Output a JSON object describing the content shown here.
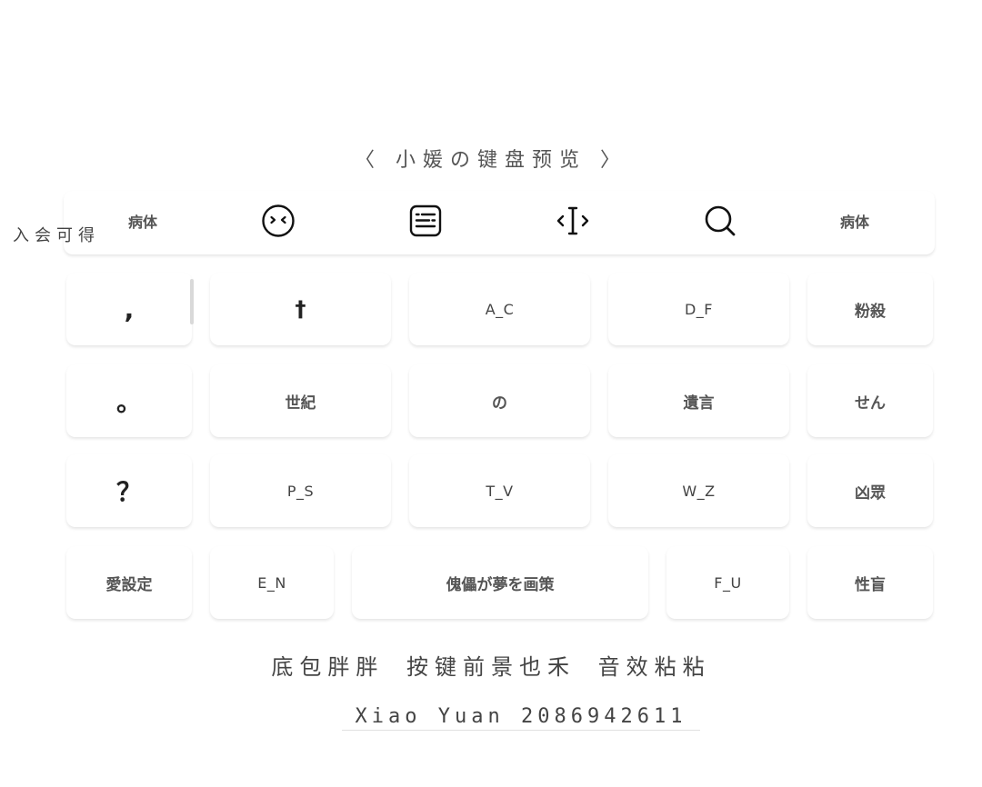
{
  "title": "〈 小媛の键盘预览 〉",
  "side_note": "入会可得",
  "toolbar": {
    "left_label": "病体",
    "right_label": "病体",
    "icons": [
      "emoji-face-icon",
      "keyboard-icon",
      "text-cursor-icon",
      "search-icon"
    ]
  },
  "keys": {
    "row1": [
      ",",
      "†",
      "A_C",
      "D_F",
      "粉殺"
    ],
    "row2": [
      "。",
      "世紀",
      "の",
      "遺言",
      "せん"
    ],
    "row3": [
      "？",
      "P_S",
      "T_V",
      "W_Z",
      "凶眾"
    ],
    "row4": [
      "愛設定",
      "E_N",
      "傀儡が夢を画策",
      "F_U",
      "性盲"
    ]
  },
  "footer": {
    "line1": "底包胖胖  按键前景也禾  音效粘粘",
    "line2": "Xiao Yuan 2086942611"
  }
}
